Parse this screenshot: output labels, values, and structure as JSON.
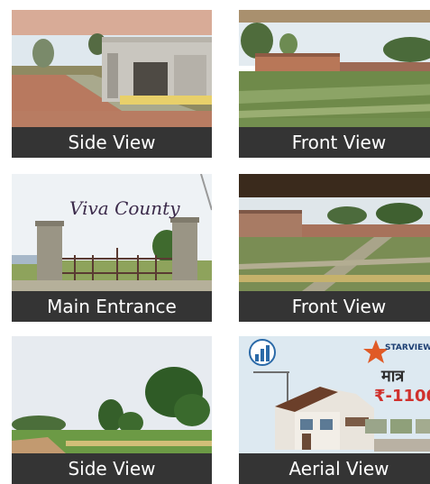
{
  "gallery": {
    "items": [
      {
        "caption": "Side View"
      },
      {
        "caption": "Front View"
      },
      {
        "caption": "Main Entrance",
        "sign_text": "Viva County"
      },
      {
        "caption": "Front View"
      },
      {
        "caption": "Side View"
      },
      {
        "caption": "Aerial View",
        "brand": "STARVIEW",
        "price_label": "मात्र",
        "price": "₹-1100"
      }
    ]
  }
}
